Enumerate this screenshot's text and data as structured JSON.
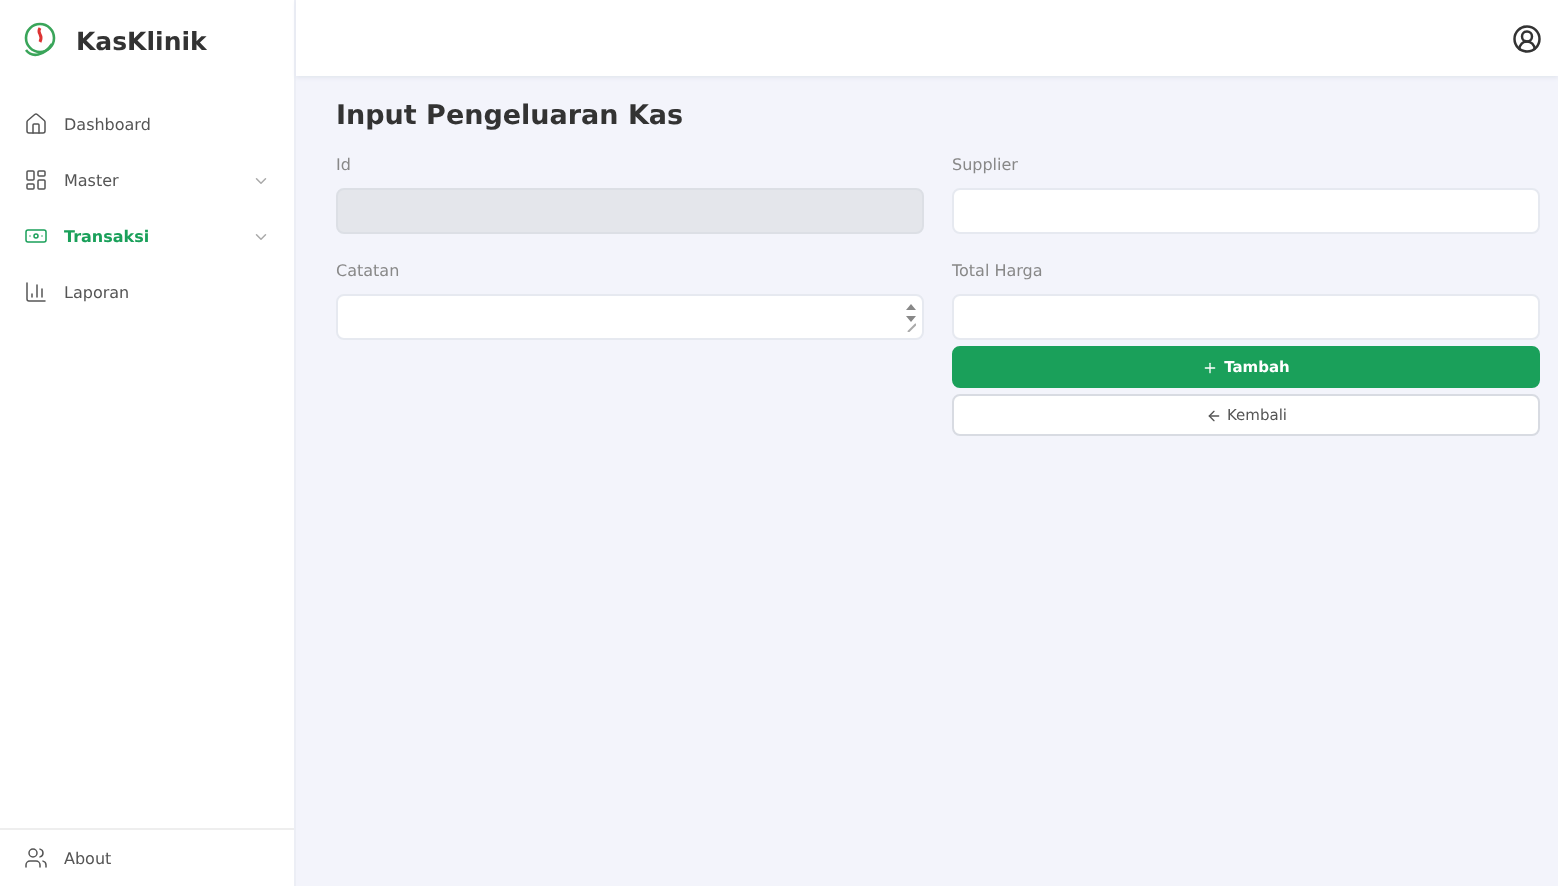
{
  "app": {
    "name": "KasKlinik"
  },
  "sidebar": {
    "items": [
      {
        "label": "Dashboard",
        "kind": "link",
        "selected": false
      },
      {
        "label": "Master",
        "kind": "submenu",
        "selected": false
      },
      {
        "label": "Transaksi",
        "kind": "submenu",
        "selected": true
      },
      {
        "label": "Laporan",
        "kind": "link",
        "selected": false
      }
    ],
    "footer": {
      "label": "About"
    }
  },
  "form": {
    "title": "Input Pengeluaran Kas",
    "columns": [
      {
        "fields": [
          {
            "label": "Id",
            "kind": "text",
            "disabled": true
          },
          {
            "label": "Catatan",
            "kind": "textarea",
            "disabled": false
          }
        ]
      },
      {
        "fields": [
          {
            "label": "Supplier",
            "kind": "text",
            "disabled": false
          },
          {
            "label": "Total Harga",
            "kind": "text",
            "disabled": false
          }
        ],
        "buttons": [
          {
            "label": "Tambah",
            "kind": "primary"
          },
          {
            "label": "Kembali",
            "kind": "secondary"
          }
        ]
      }
    ]
  }
}
